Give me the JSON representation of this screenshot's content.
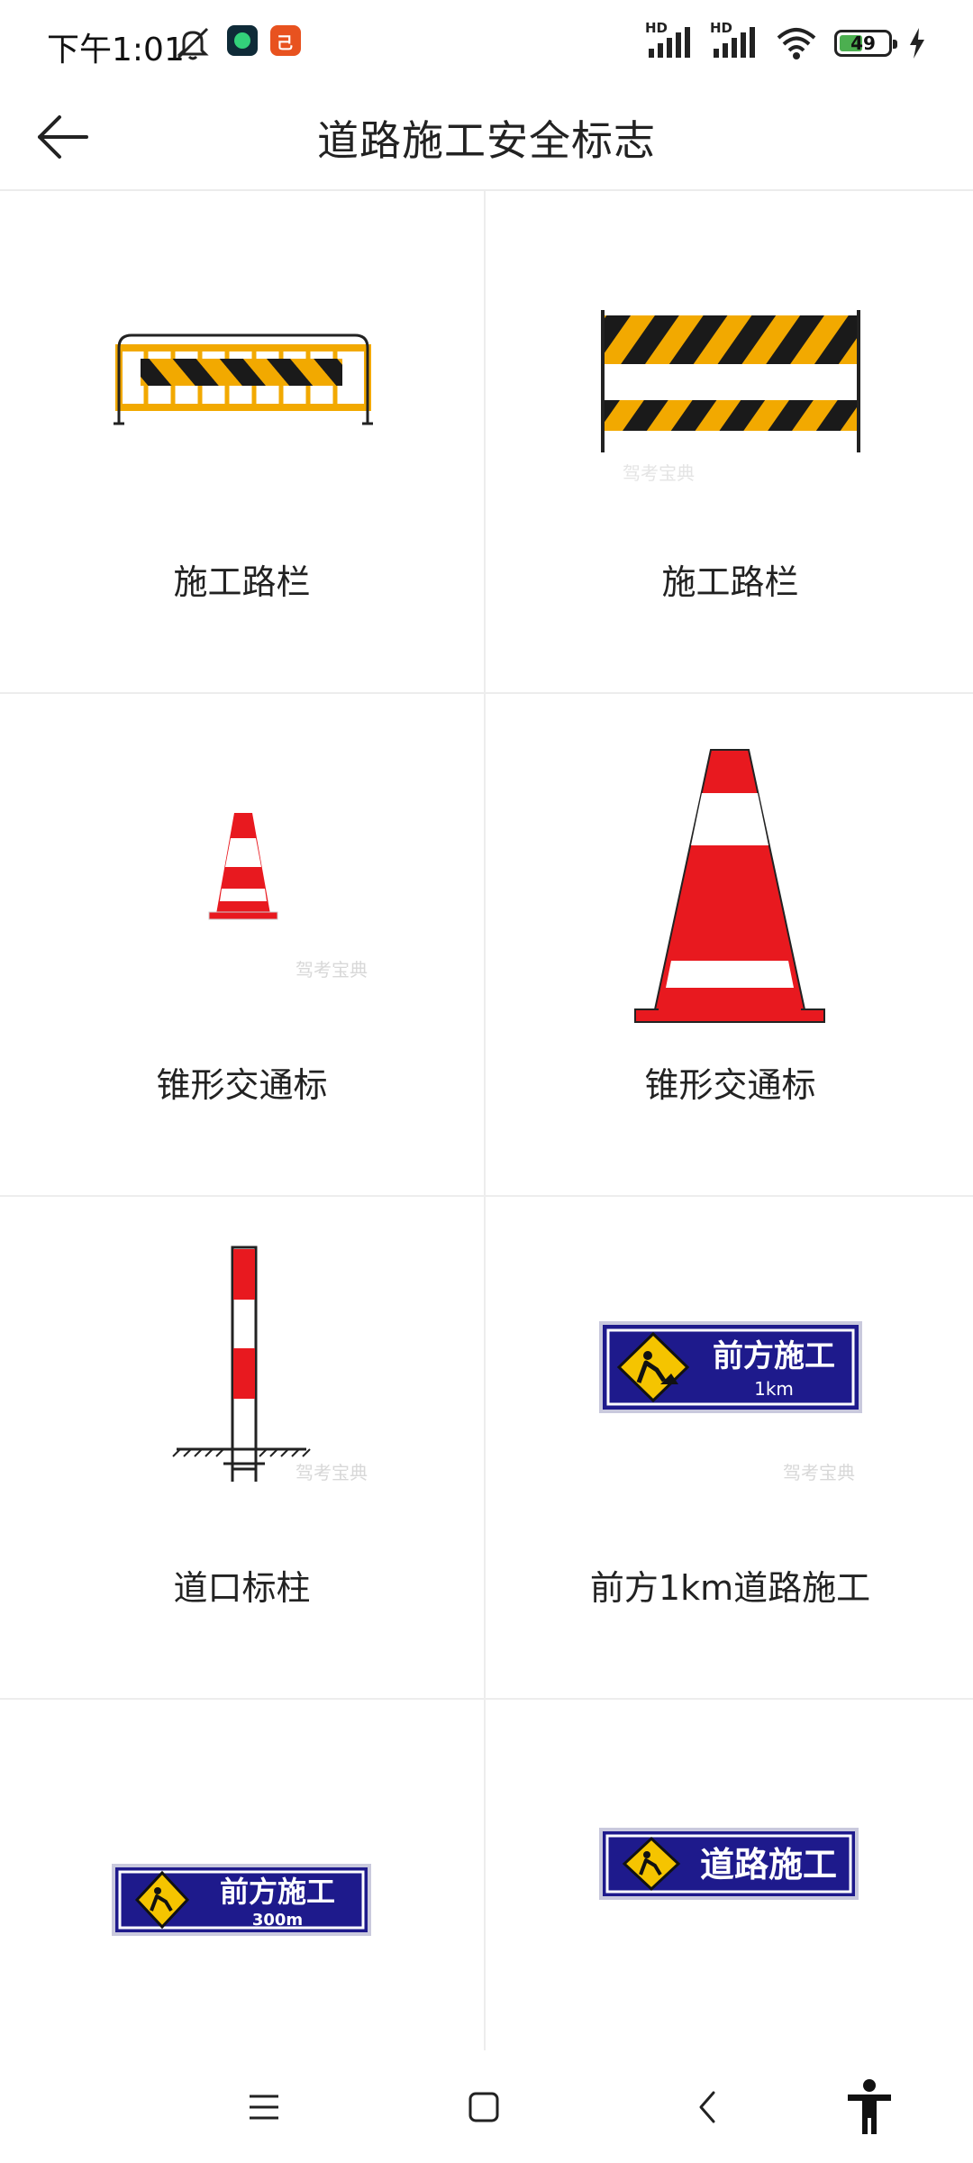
{
  "status_bar": {
    "time": "下午1:01",
    "battery_level": "49",
    "battery_fraction": 0.49,
    "icons": [
      "mute-icon",
      "app-icon-green",
      "app-icon-red",
      "signal-hd-icon",
      "signal-hd-icon",
      "wifi-icon",
      "battery-icon",
      "charging-icon"
    ]
  },
  "header": {
    "title": "道路施工安全标志",
    "back_icon": "arrow-left-icon"
  },
  "signs": [
    {
      "label": "施工路栏",
      "image": "barrier-fence-striped"
    },
    {
      "label": "施工路栏",
      "image": "barrier-board-striped"
    },
    {
      "label": "锥形交通标",
      "image": "traffic-cone-small"
    },
    {
      "label": "锥形交通标",
      "image": "traffic-cone-large"
    },
    {
      "label": "道口标柱",
      "image": "crossing-marker-post"
    },
    {
      "label": "前方1km道路施工",
      "image": "roadwork-ahead-sign-1km",
      "sign_text": "前方施工",
      "sign_distance": "1km"
    },
    {
      "label": "",
      "image": "roadwork-ahead-sign-300m",
      "sign_text": "前方施工",
      "sign_distance": "300m"
    },
    {
      "label": "",
      "image": "road-construction-sign",
      "sign_text": "道路施工"
    }
  ],
  "watermark": "驾考宝典",
  "colors": {
    "sign_blue": "#1e1a8c",
    "warning_yellow": "#f5c400",
    "cone_red": "#e8191f",
    "barrier_orange": "#f2a900"
  },
  "nav_bar": {
    "icons": [
      "menu-icon",
      "home-icon",
      "back-icon",
      "accessibility-icon"
    ]
  }
}
